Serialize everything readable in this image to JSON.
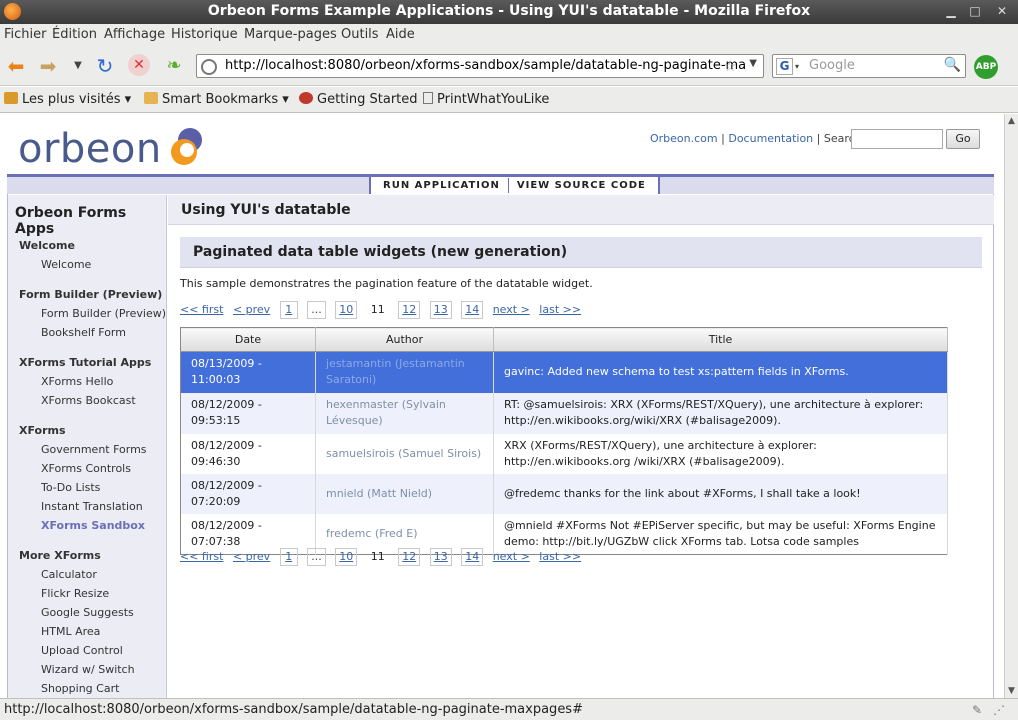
{
  "window": {
    "title": "Orbeon Forms Example Applications - Using YUI's datatable - Mozilla Firefox"
  },
  "menu": [
    "Fichier",
    "Édition",
    "Affichage",
    "Historique",
    "Marque-pages",
    "Outils",
    "Aide"
  ],
  "navigation": {
    "url": "http://localhost:8080/orbeon/xforms-sandbox/sample/datatable-ng-paginate-ma",
    "search_placeholder": "Google",
    "search_engine": "G",
    "addon": "ABP"
  },
  "bookmarks": [
    "Les plus visités",
    "Smart Bookmarks",
    "Getting Started",
    "PrintWhatYouLike"
  ],
  "site": {
    "logo": "orbeon",
    "links": {
      "orbeon": "Orbeon.com",
      "sep": "|",
      "docs": "Documentation",
      "search_label": "| Search:"
    },
    "go_label": "Go",
    "tabs": [
      "RUN APPLICATION",
      "VIEW SOURCE CODE"
    ]
  },
  "sidebar": {
    "title": "Orbeon Forms Apps",
    "sections": [
      {
        "label": "Welcome",
        "items": [
          "Welcome"
        ]
      },
      {
        "label": "Form Builder (Preview)",
        "items": [
          "Form Builder (Preview)",
          "Bookshelf Form"
        ]
      },
      {
        "label": "XForms Tutorial Apps",
        "items": [
          "XForms Hello",
          "XForms Bookcast"
        ]
      },
      {
        "label": "XForms",
        "items": [
          "Government Forms",
          "XForms Controls",
          "To-Do Lists",
          "Instant Translation",
          "XForms Sandbox"
        ]
      },
      {
        "label": "More XForms",
        "items": [
          "Calculator",
          "Flickr Resize",
          "Google Suggests",
          "HTML Area",
          "Upload Control",
          "Wizard w/ Switch",
          "Shopping Cart"
        ]
      }
    ]
  },
  "main": {
    "title": "Using YUI's datatable",
    "subtitle": "Paginated data table widgets (new generation)",
    "description": "This sample demonstratres the pagination feature of the datatable widget."
  },
  "pager": {
    "first": "<< first",
    "prev": "< prev",
    "pages": [
      "1",
      "...",
      "10",
      "11",
      "12",
      "13",
      "14"
    ],
    "current": "11",
    "next": "next >",
    "last": "last >>"
  },
  "table": {
    "columns": [
      "Date",
      "Author",
      "Title"
    ],
    "rows": [
      {
        "date": "08/13/2009 - 11:00:03",
        "author": "jestamantin (Jestamantin Saratoni)",
        "title": "gavinc: Added new schema to test xs:pattern fields in XForms.",
        "selected": true
      },
      {
        "date": "08/12/2009 - 09:53:15",
        "author": "hexenmaster (Sylvain Lévesque)",
        "title": "RT: @samuelsirois: XRX (XForms/REST/XQuery), une architecture à explorer: http://en.wikibooks.org/wiki/XRX (#balisage2009)."
      },
      {
        "date": "08/12/2009 - 09:46:30",
        "author": "samuelsirois (Samuel Sirois)",
        "title": "XRX (XForms/REST/XQuery), une architecture à explorer: http://en.wikibooks.org /wiki/XRX (#balisage2009)."
      },
      {
        "date": "08/12/2009 - 07:20:09",
        "author": "mnield (Matt Nield)",
        "title": "@fredemc thanks for the link about #XForms, I shall take a look!"
      },
      {
        "date": "08/12/2009 - 07:07:38",
        "author": "fredemc (Fred E)",
        "title": "@mnield #XForms Not #EPiServer specific, but may be useful: XForms Engine demo: http://bit.ly/UGZbW click XForms tab. Lotsa code samples"
      }
    ]
  },
  "status": {
    "text": "http://localhost:8080/orbeon/xforms-sandbox/sample/datatable-ng-paginate-maxpages#"
  },
  "colors": {
    "accent": "#6b6fb5",
    "selected_row": "#426fd9",
    "link": "#3a66a7"
  }
}
